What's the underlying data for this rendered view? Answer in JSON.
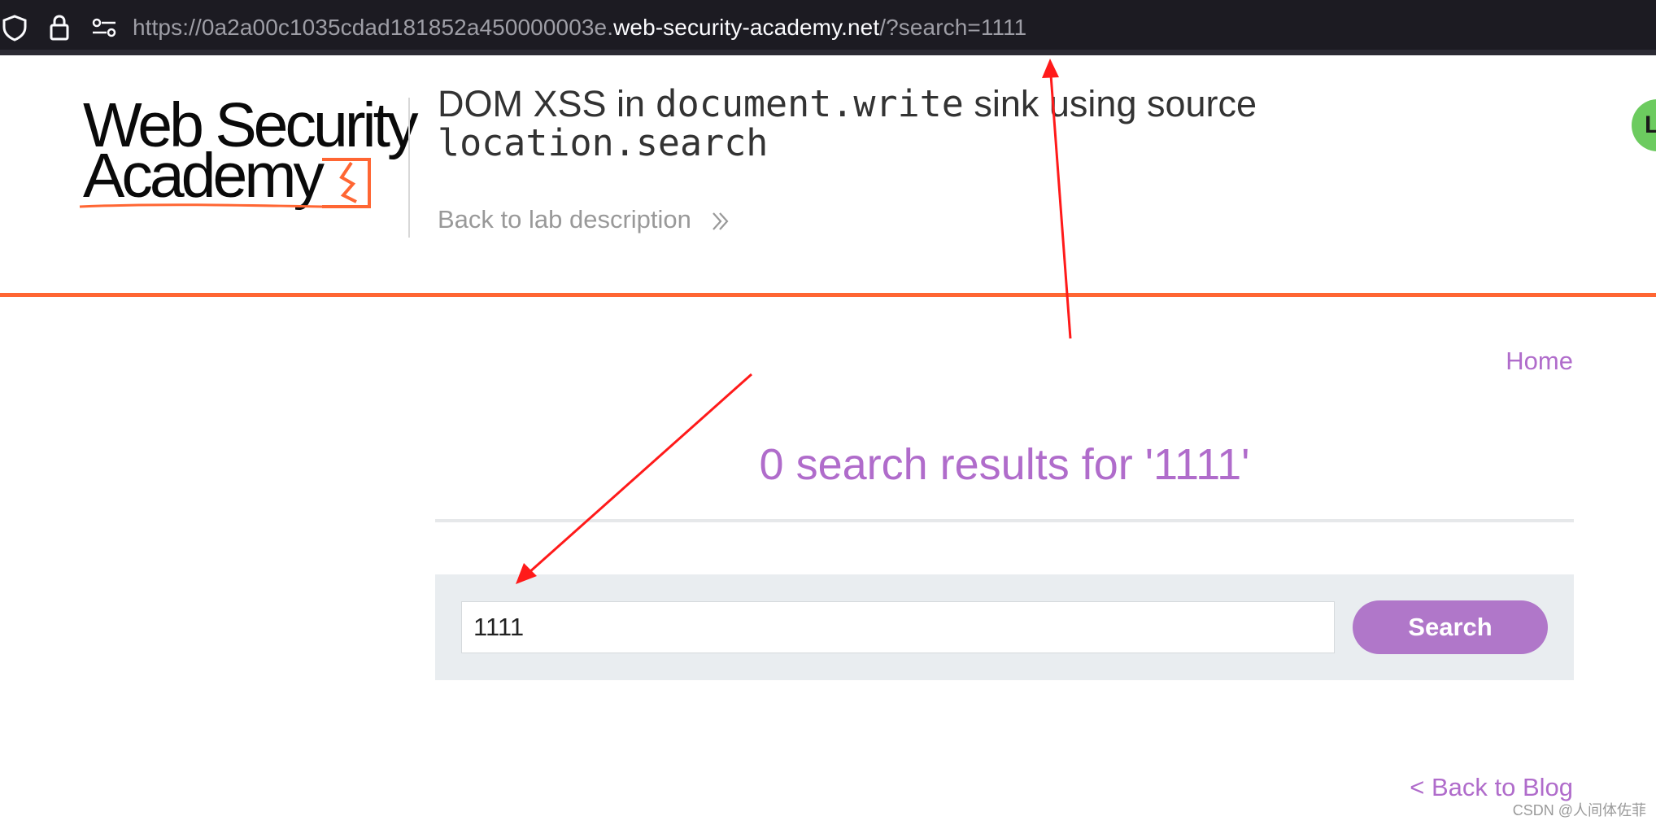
{
  "browser": {
    "url_prefix": "https://0a2a00c1035cdad181852a450000003e.",
    "url_host": "web-security-academy.net",
    "url_suffix": "/?search=1111",
    "icons": [
      "shield-icon",
      "lock-icon",
      "site-settings-icon"
    ]
  },
  "header": {
    "logo_line1": "Web Security",
    "logo_line2": "Academy",
    "title_plain_1": "DOM XSS in ",
    "title_code_1": "document.write",
    "title_plain_2": " sink using source",
    "title_code_2": "location.search",
    "back_to_lab": "Back to lab description",
    "avatar_initial": "L"
  },
  "nav": {
    "home": "Home"
  },
  "main": {
    "results_heading": "0 search results for '1111'",
    "search_value": "1111",
    "search_button": "Search",
    "back_to_blog": "< Back to Blog"
  },
  "footer": {
    "watermark": "CSDN @人间体佐菲"
  },
  "colors": {
    "accent_orange": "#ff6633",
    "link_purple": "#b06ccb",
    "button_purple": "#b077c9",
    "annotation_red": "#ff1a1a"
  }
}
